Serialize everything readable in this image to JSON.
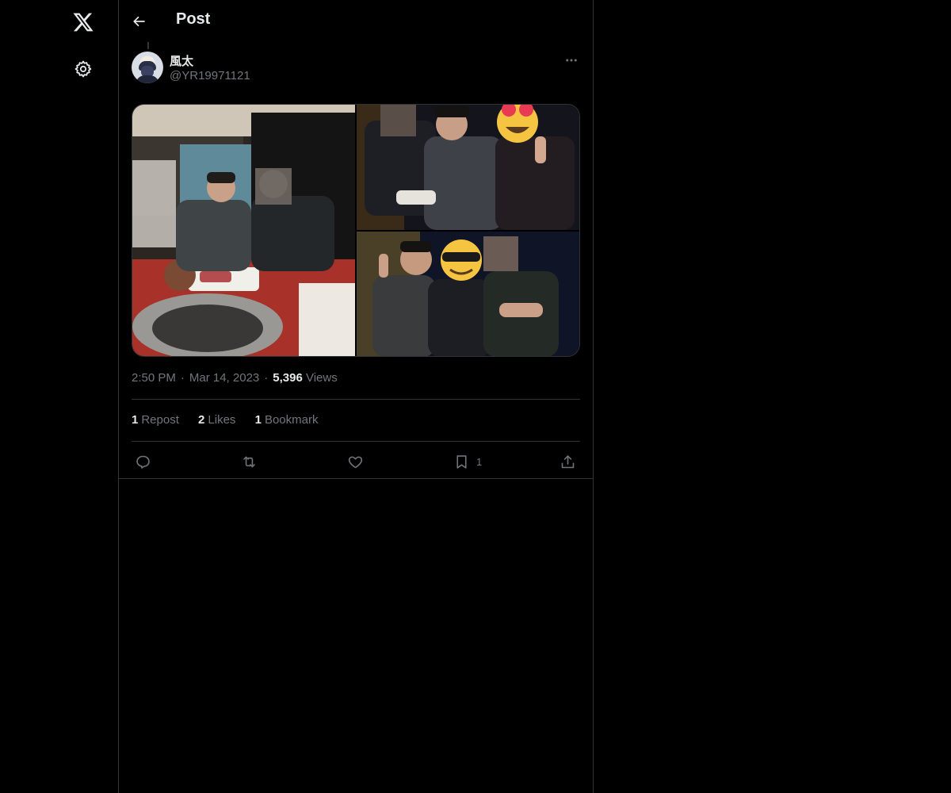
{
  "nav": {
    "logo_icon": "x-logo-icon",
    "settings_icon": "gear-icon"
  },
  "header": {
    "title": "Post",
    "back_icon": "arrow-left-icon"
  },
  "post": {
    "author": {
      "display_name": "風太",
      "handle": "@YR19971121"
    },
    "more_icon": "more-horizontal-icon",
    "media": [
      {
        "description": "restaurant photo"
      },
      {
        "description": "group photo"
      },
      {
        "description": "group photo"
      }
    ],
    "time": "2:50 PM",
    "dot": "·",
    "date": "Mar 14, 2023",
    "views_count": "5,396",
    "views_label": "Views",
    "stats": {
      "reposts_count": "1",
      "reposts_label": "Repost",
      "likes_count": "2",
      "likes_label": "Likes",
      "bookmarks_count": "1",
      "bookmarks_label": "Bookmark"
    },
    "actions": {
      "reply_icon": "reply-icon",
      "repost_icon": "repost-icon",
      "like_icon": "heart-icon",
      "bookmark_icon": "bookmark-icon",
      "bookmark_count": "1",
      "share_icon": "share-icon"
    }
  },
  "colors": {
    "background": "#000000",
    "text_primary": "#e7e9ea",
    "text_secondary": "#71767b",
    "border": "#2f3336"
  }
}
